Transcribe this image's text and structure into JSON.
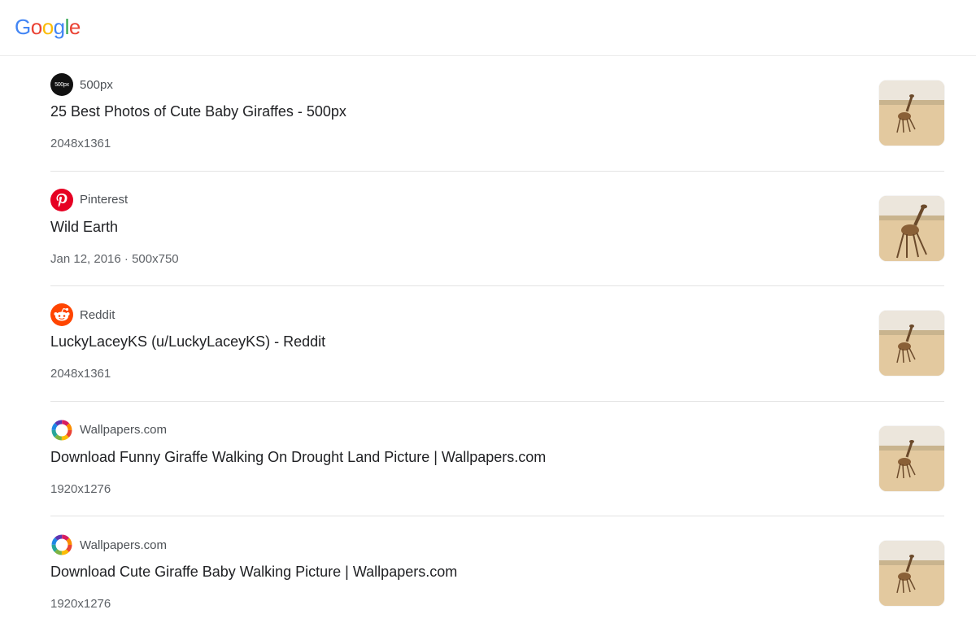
{
  "header": {
    "logo_letters": [
      {
        "char": "G",
        "color": "#4285F4"
      },
      {
        "char": "o",
        "color": "#EA4335"
      },
      {
        "char": "o",
        "color": "#FBBC05"
      },
      {
        "char": "g",
        "color": "#4285F4"
      },
      {
        "char": "l",
        "color": "#34A853"
      },
      {
        "char": "e",
        "color": "#EA4335"
      }
    ]
  },
  "results": [
    {
      "source": "500px",
      "icon": "500px-icon",
      "title": "25 Best Photos of Cute Baby Giraffes - 500px",
      "meta": "2048x1361"
    },
    {
      "source": "Pinterest",
      "icon": "pinterest-icon",
      "title": "Wild Earth",
      "meta": "Jan 12, 2016 · 500x750"
    },
    {
      "source": "Reddit",
      "icon": "reddit-icon",
      "title": "LuckyLaceyKS (u/LuckyLaceyKS) - Reddit",
      "meta": "2048x1361"
    },
    {
      "source": "Wallpapers.com",
      "icon": "wallpapers-icon",
      "title": "Download Funny Giraffe Walking On Drought Land Picture | Wallpapers.com",
      "meta": "1920x1276"
    },
    {
      "source": "Wallpapers.com",
      "icon": "wallpapers-icon",
      "title": "Download Cute Giraffe Baby Walking Picture | Wallpapers.com",
      "meta": "1920x1276"
    }
  ],
  "favicon_500px_text": "500px",
  "colors": {
    "pinterest": "#E60023",
    "reddit": "#FF4500",
    "divider": "#e3e3e3"
  }
}
